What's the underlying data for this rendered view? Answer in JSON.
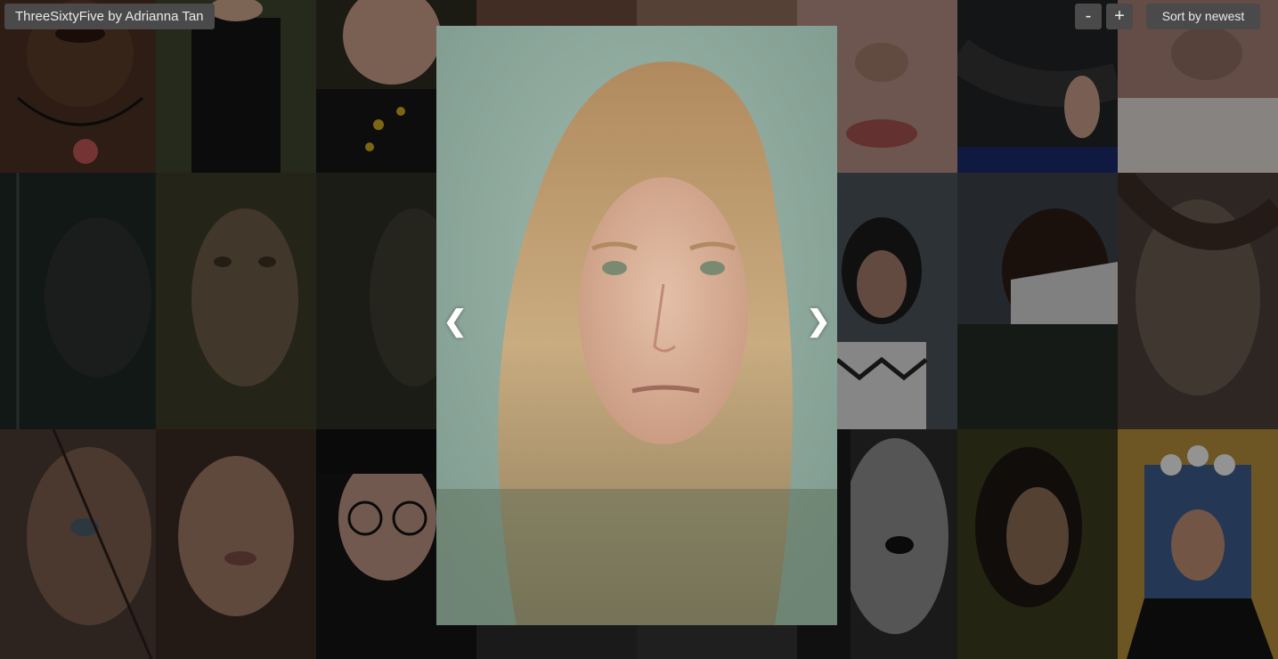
{
  "header": {
    "title": "ThreeSixtyFive by Adrianna Tan",
    "zoom_out_label": "-",
    "zoom_in_label": "+",
    "sort_label": "Sort by newest"
  },
  "lightbox": {
    "prev_label": "❮",
    "next_label": "❯"
  },
  "gallery": {
    "tile_count": 24
  }
}
